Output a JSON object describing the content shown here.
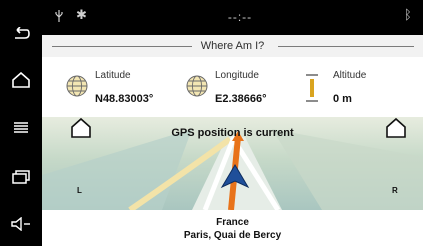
{
  "status_bar": {
    "center_text": "--:--",
    "icons": [
      "usb-icon",
      "settings-gear-icon",
      "bluetooth-icon"
    ]
  },
  "header": {
    "title": "Where Am I?"
  },
  "coordinates": {
    "latitude_label": "Latitude",
    "latitude_value": "N48.83003°",
    "longitude_label": "Longitude",
    "longitude_value": "E2.38666°",
    "altitude_label": "Altitude",
    "altitude_value": "0 m"
  },
  "map": {
    "gps_status": "GPS position is current",
    "left_button_letter": "L",
    "right_button_letter": "R"
  },
  "address": {
    "country": "France",
    "street": "Paris, Quai de Bercy"
  },
  "side_nav": [
    "back-icon",
    "home-icon",
    "menu-icon",
    "window-icon",
    "volume-icon"
  ],
  "colors": {
    "background": "#ffffff",
    "nav_background": "#000000",
    "map_background": "#b6cfc8",
    "road": "#ffffff",
    "route": "#e8731a",
    "position_arrow": "#1f4f9a",
    "altitude_icon": "#d9a420"
  }
}
